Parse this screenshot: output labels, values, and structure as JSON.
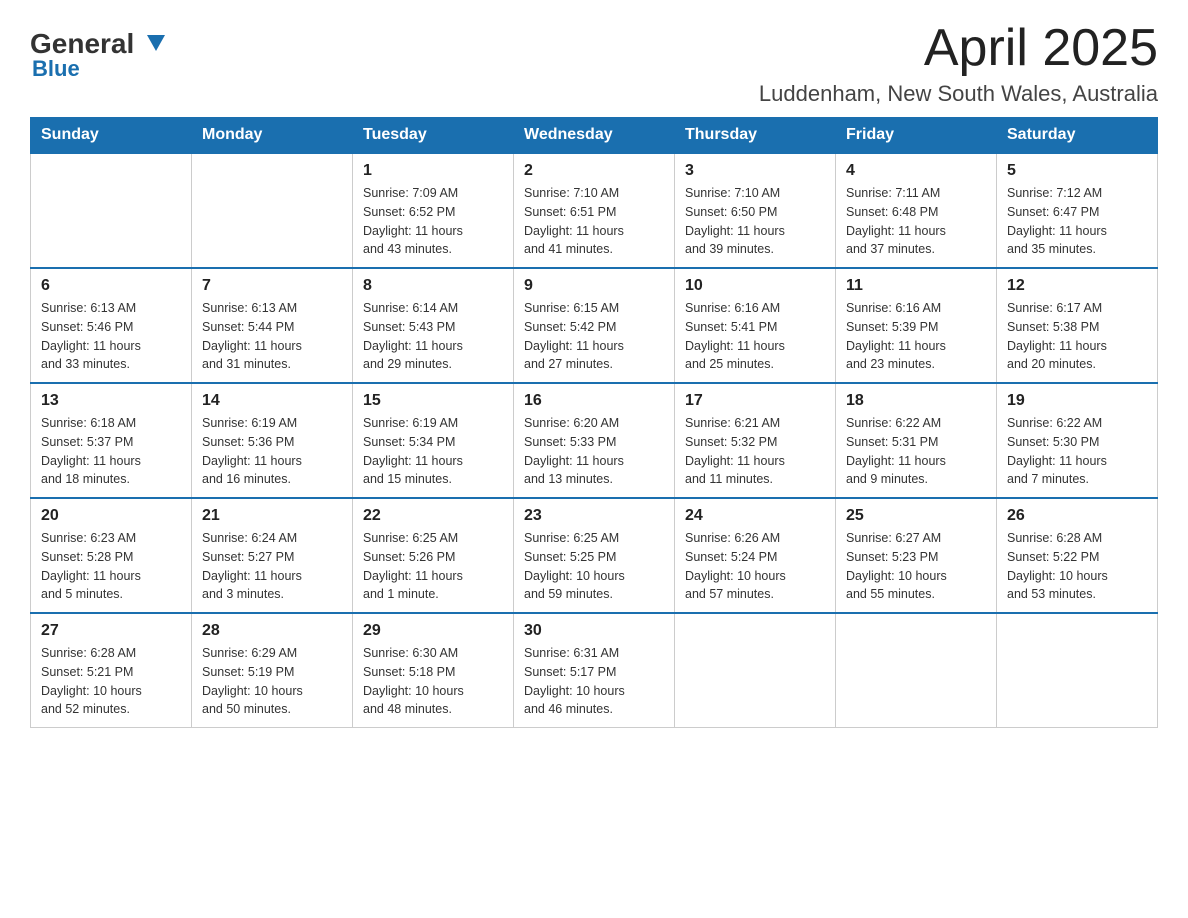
{
  "header": {
    "logo_main": "General",
    "logo_sub": "Blue",
    "month_title": "April 2025",
    "location": "Luddenham, New South Wales, Australia"
  },
  "weekdays": [
    "Sunday",
    "Monday",
    "Tuesday",
    "Wednesday",
    "Thursday",
    "Friday",
    "Saturday"
  ],
  "weeks": [
    [
      {
        "day": "",
        "info": ""
      },
      {
        "day": "",
        "info": ""
      },
      {
        "day": "1",
        "info": "Sunrise: 7:09 AM\nSunset: 6:52 PM\nDaylight: 11 hours\nand 43 minutes."
      },
      {
        "day": "2",
        "info": "Sunrise: 7:10 AM\nSunset: 6:51 PM\nDaylight: 11 hours\nand 41 minutes."
      },
      {
        "day": "3",
        "info": "Sunrise: 7:10 AM\nSunset: 6:50 PM\nDaylight: 11 hours\nand 39 minutes."
      },
      {
        "day": "4",
        "info": "Sunrise: 7:11 AM\nSunset: 6:48 PM\nDaylight: 11 hours\nand 37 minutes."
      },
      {
        "day": "5",
        "info": "Sunrise: 7:12 AM\nSunset: 6:47 PM\nDaylight: 11 hours\nand 35 minutes."
      }
    ],
    [
      {
        "day": "6",
        "info": "Sunrise: 6:13 AM\nSunset: 5:46 PM\nDaylight: 11 hours\nand 33 minutes."
      },
      {
        "day": "7",
        "info": "Sunrise: 6:13 AM\nSunset: 5:44 PM\nDaylight: 11 hours\nand 31 minutes."
      },
      {
        "day": "8",
        "info": "Sunrise: 6:14 AM\nSunset: 5:43 PM\nDaylight: 11 hours\nand 29 minutes."
      },
      {
        "day": "9",
        "info": "Sunrise: 6:15 AM\nSunset: 5:42 PM\nDaylight: 11 hours\nand 27 minutes."
      },
      {
        "day": "10",
        "info": "Sunrise: 6:16 AM\nSunset: 5:41 PM\nDaylight: 11 hours\nand 25 minutes."
      },
      {
        "day": "11",
        "info": "Sunrise: 6:16 AM\nSunset: 5:39 PM\nDaylight: 11 hours\nand 23 minutes."
      },
      {
        "day": "12",
        "info": "Sunrise: 6:17 AM\nSunset: 5:38 PM\nDaylight: 11 hours\nand 20 minutes."
      }
    ],
    [
      {
        "day": "13",
        "info": "Sunrise: 6:18 AM\nSunset: 5:37 PM\nDaylight: 11 hours\nand 18 minutes."
      },
      {
        "day": "14",
        "info": "Sunrise: 6:19 AM\nSunset: 5:36 PM\nDaylight: 11 hours\nand 16 minutes."
      },
      {
        "day": "15",
        "info": "Sunrise: 6:19 AM\nSunset: 5:34 PM\nDaylight: 11 hours\nand 15 minutes."
      },
      {
        "day": "16",
        "info": "Sunrise: 6:20 AM\nSunset: 5:33 PM\nDaylight: 11 hours\nand 13 minutes."
      },
      {
        "day": "17",
        "info": "Sunrise: 6:21 AM\nSunset: 5:32 PM\nDaylight: 11 hours\nand 11 minutes."
      },
      {
        "day": "18",
        "info": "Sunrise: 6:22 AM\nSunset: 5:31 PM\nDaylight: 11 hours\nand 9 minutes."
      },
      {
        "day": "19",
        "info": "Sunrise: 6:22 AM\nSunset: 5:30 PM\nDaylight: 11 hours\nand 7 minutes."
      }
    ],
    [
      {
        "day": "20",
        "info": "Sunrise: 6:23 AM\nSunset: 5:28 PM\nDaylight: 11 hours\nand 5 minutes."
      },
      {
        "day": "21",
        "info": "Sunrise: 6:24 AM\nSunset: 5:27 PM\nDaylight: 11 hours\nand 3 minutes."
      },
      {
        "day": "22",
        "info": "Sunrise: 6:25 AM\nSunset: 5:26 PM\nDaylight: 11 hours\nand 1 minute."
      },
      {
        "day": "23",
        "info": "Sunrise: 6:25 AM\nSunset: 5:25 PM\nDaylight: 10 hours\nand 59 minutes."
      },
      {
        "day": "24",
        "info": "Sunrise: 6:26 AM\nSunset: 5:24 PM\nDaylight: 10 hours\nand 57 minutes."
      },
      {
        "day": "25",
        "info": "Sunrise: 6:27 AM\nSunset: 5:23 PM\nDaylight: 10 hours\nand 55 minutes."
      },
      {
        "day": "26",
        "info": "Sunrise: 6:28 AM\nSunset: 5:22 PM\nDaylight: 10 hours\nand 53 minutes."
      }
    ],
    [
      {
        "day": "27",
        "info": "Sunrise: 6:28 AM\nSunset: 5:21 PM\nDaylight: 10 hours\nand 52 minutes."
      },
      {
        "day": "28",
        "info": "Sunrise: 6:29 AM\nSunset: 5:19 PM\nDaylight: 10 hours\nand 50 minutes."
      },
      {
        "day": "29",
        "info": "Sunrise: 6:30 AM\nSunset: 5:18 PM\nDaylight: 10 hours\nand 48 minutes."
      },
      {
        "day": "30",
        "info": "Sunrise: 6:31 AM\nSunset: 5:17 PM\nDaylight: 10 hours\nand 46 minutes."
      },
      {
        "day": "",
        "info": ""
      },
      {
        "day": "",
        "info": ""
      },
      {
        "day": "",
        "info": ""
      }
    ]
  ]
}
